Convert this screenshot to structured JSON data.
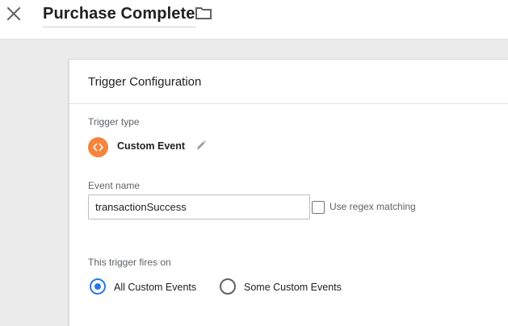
{
  "header": {
    "title": "Purchase Complete",
    "close_icon": "close-icon",
    "folder_icon": "folder-icon"
  },
  "card": {
    "title": "Trigger Configuration",
    "trigger_type_label": "Trigger type",
    "trigger_type": {
      "name": "Custom Event",
      "icon": "code-brackets-icon",
      "icon_color": "#f5843c",
      "edit_icon": "pencil-icon"
    },
    "event_name_label": "Event name",
    "event_name_value": "transactionSuccess",
    "regex_checkbox": {
      "label": "Use regex matching",
      "checked": false
    },
    "fires_on_label": "This trigger fires on",
    "fires_on_options": [
      {
        "label": "All Custom Events",
        "selected": true
      },
      {
        "label": "Some Custom Events",
        "selected": false
      }
    ]
  },
  "colors": {
    "accent": "#2a7ae2",
    "background": "#ececec"
  }
}
